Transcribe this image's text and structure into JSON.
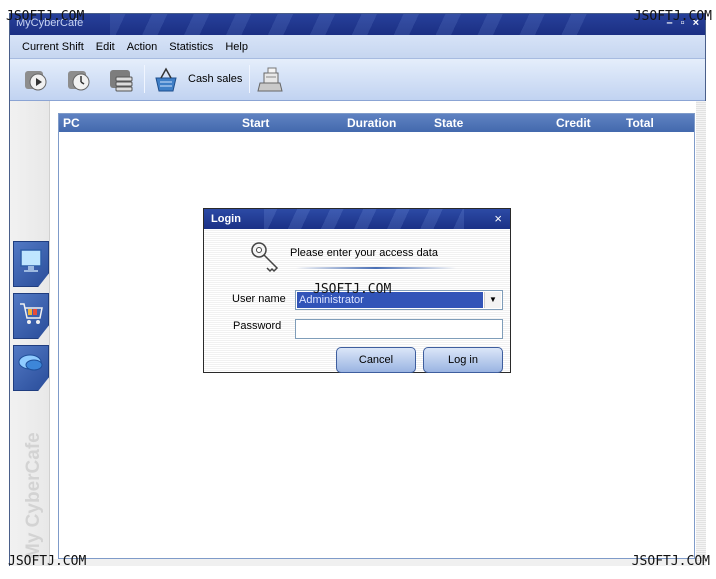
{
  "app": {
    "title": "MyCyberCafe"
  },
  "watermarks": {
    "text": "JSOFTJ.COM"
  },
  "menu": [
    "Current Shift",
    "Edit",
    "Action",
    "Statistics",
    "Help"
  ],
  "toolbar": {
    "cash_sales_label": "Cash sales"
  },
  "grid": {
    "columns": [
      "PC",
      "Start",
      "Duration",
      "State",
      "Credit",
      "Total"
    ]
  },
  "sidebar": {
    "logo_text": "My CyberCafe"
  },
  "login_dialog": {
    "title": "Login",
    "prompt": "Please enter your access data",
    "username_label": "User name",
    "username_value": "Administrator",
    "password_label": "Password",
    "password_value": "",
    "cancel_label": "Cancel",
    "login_label": "Log in"
  }
}
